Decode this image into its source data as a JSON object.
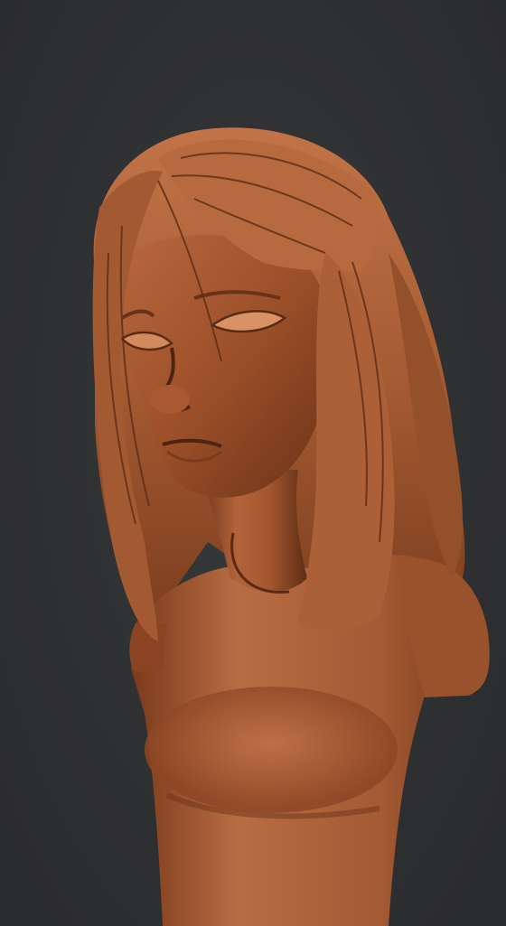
{
  "scene": {
    "subject": "sculpt-render",
    "background_color": "#2e2f31",
    "material_color": "#a85a34",
    "material_highlight": "#d8895a",
    "material_shadow": "#5a2a14"
  }
}
